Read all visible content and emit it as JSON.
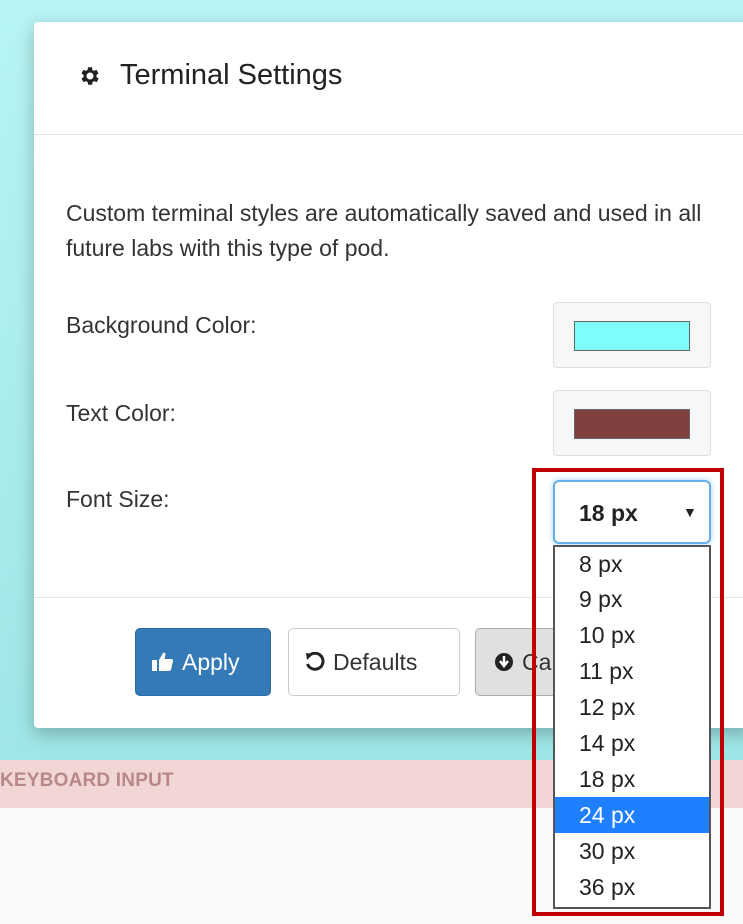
{
  "modal": {
    "title": "Terminal Settings",
    "title_icon": "gear-icon",
    "description": "Custom terminal styles are automatically saved and used in all future labs with this type of pod.",
    "fields": {
      "background_label": "Background Color:",
      "background_color": "#7ffcfc",
      "text_label": "Text Color:",
      "text_color": "#7f3f3f",
      "font_size_label": "Font Size:",
      "font_size_value": "18 px"
    },
    "font_size_options": [
      "8 px",
      "9 px",
      "10 px",
      "11 px",
      "12 px",
      "14 px",
      "18 px",
      "24 px",
      "30 px",
      "36 px"
    ],
    "highlighted_option": "24 px",
    "buttons": {
      "apply": "Apply",
      "apply_icon": "thumbs-up-icon",
      "defaults": "Defaults",
      "defaults_icon": "undo-icon",
      "cancel": "Ca",
      "cancel_icon": "circle-down-arrow-icon"
    }
  },
  "background_section_label": "KEYBOARD INPUT",
  "colors": {
    "primary_button": "#337ab7",
    "highlight_border": "#c00000",
    "selected_option": "#1e7fff",
    "page_background": "#a8ecec",
    "keyboard_strip": "#f2d6d6"
  }
}
